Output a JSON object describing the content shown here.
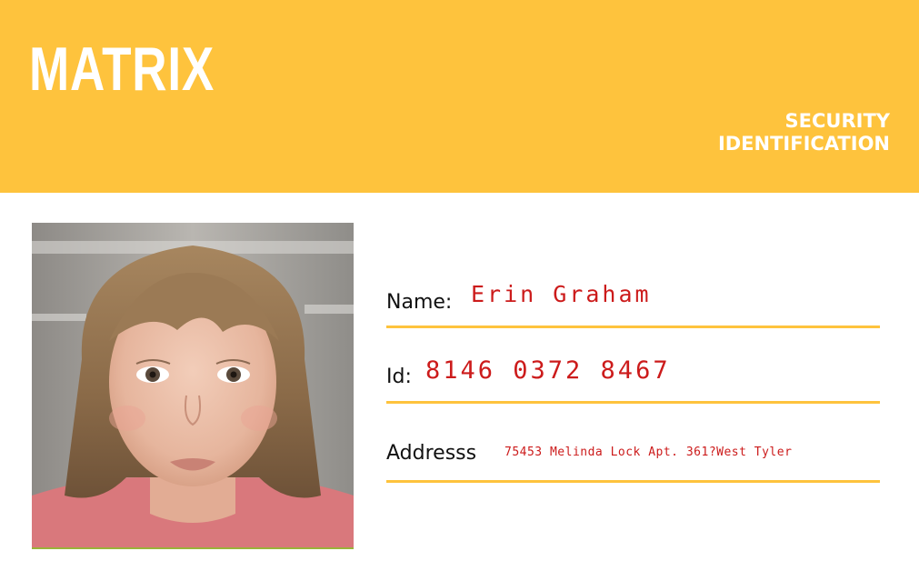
{
  "header": {
    "brand": "MATRIX",
    "subtitle_line1": "SECURITY",
    "subtitle_line2": "IDENTIFICATION",
    "background_color": "#fec33d"
  },
  "photo": {
    "description_icon": "portrait-photo"
  },
  "fields": {
    "name": {
      "label": "Name:",
      "value": "Erin Graham"
    },
    "id": {
      "label": "Id:",
      "value": "8146 0372 8467"
    },
    "address": {
      "label": "Addresss",
      "value": "75453 Melinda Lock Apt. 361?West Tyler"
    }
  },
  "colors": {
    "accent": "#fec33d",
    "value_text": "#cc1b1b",
    "label_text": "#111111"
  }
}
